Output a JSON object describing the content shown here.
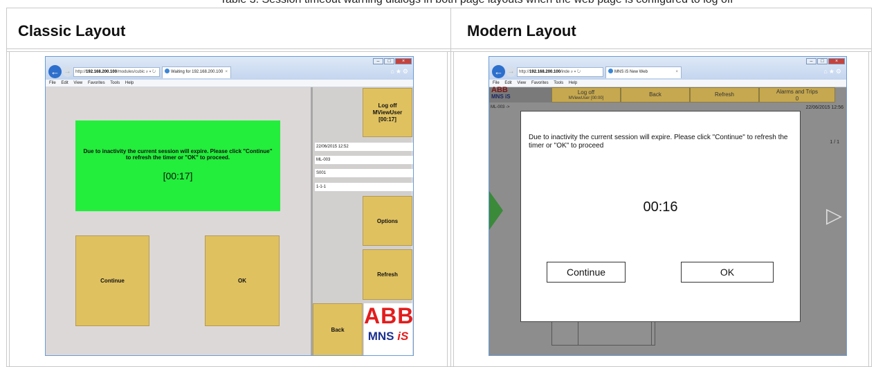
{
  "intro_text": "Table 3. Session timeout warning dialogs in both page layouts when the web page is configured to log off",
  "columns": {
    "classic_header": "Classic Layout",
    "modern_header": "Modern Layout"
  },
  "classic": {
    "browser": {
      "address_prefix": "http://",
      "address_host": "192.168.200.100",
      "address_rest": "/modules/cubic",
      "address_icons": "⌕ ▾ ↻",
      "tab_title": "Waiting for 192.168.200.100",
      "menu": [
        "File",
        "Edit",
        "View",
        "Favorites",
        "Tools",
        "Help"
      ]
    },
    "dialog": {
      "message": "Due to inactivity the current session will expire. Please click \"Continue\" to refresh the timer or \"OK\" to proceed.",
      "timer": "[00:17]",
      "continue_label": "Continue",
      "ok_label": "OK"
    },
    "sidebar": {
      "logoff_line1": "Log off",
      "logoff_line2": "MViewUser",
      "logoff_line3": "[00:17]",
      "datetime": "22/06/2015 12:52",
      "field_2": "ML-003",
      "field_3": "S001",
      "field_4": "1-1-1",
      "options_label": "Options",
      "refresh_label": "Refresh",
      "back_label": "Back",
      "logo_top": "ABB",
      "logo_bottom_a": "MNS ",
      "logo_bottom_b": "iS"
    }
  },
  "modern": {
    "browser": {
      "address_prefix": "http://",
      "address_host": "192.168.200.100",
      "address_rest": "/inde",
      "address_icons": "⌕ ▾ ↻",
      "tab_title": "MNS iS New Web",
      "menu": [
        "File",
        "Edit",
        "View",
        "Favorites",
        "Tools",
        "Help"
      ]
    },
    "topbar": {
      "logo_top": "ABB",
      "logo_bottom": "MNS iS",
      "logoff_label": "Log off",
      "logoff_sub": "MViewUser [00:00]",
      "back_label": "Back",
      "refresh_label": "Refresh",
      "alarms_label": "Alarms and Trips",
      "alarms_count": "0"
    },
    "background": {
      "breadcrumb": "ML-003 ->",
      "datetime": "22/06/2015 12:56",
      "page_counter": "1 / 1"
    },
    "dialog": {
      "message": "Due to inactivity the current session will expire. Please click \"Continue\" to refresh the timer or \"OK\" to proceed",
      "timer": "00:16",
      "continue_label": "Continue",
      "ok_label": "OK"
    }
  },
  "colors": {
    "green_panel": "#22ee3b",
    "gold_button": "#e0c160",
    "abb_red": "#e21d1d",
    "mns_blue": "#1b2f8f"
  }
}
